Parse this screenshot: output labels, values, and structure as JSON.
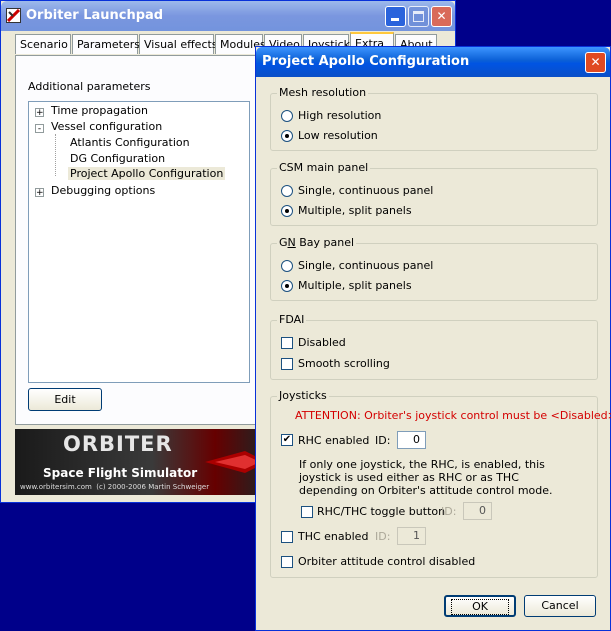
{
  "launchpad": {
    "title": "Orbiter Launchpad",
    "tabs": [
      "Scenario",
      "Parameters",
      "Visual effects",
      "Modules",
      "Video",
      "Joystick",
      "Extra",
      "About"
    ],
    "section_label": "Additional parameters",
    "tree": [
      {
        "label": "Time propagation",
        "expander": "+"
      },
      {
        "label": "Vessel configuration",
        "expander": "-"
      },
      {
        "label": "Atlantis Configuration"
      },
      {
        "label": "DG Configuration"
      },
      {
        "label": "Project Apollo Configuration"
      },
      {
        "label": "Debugging options",
        "expander": "+"
      }
    ],
    "edit_button": "Edit",
    "banner": {
      "name": "ORBITER",
      "subtitle": "Space Flight Simulator",
      "footer": "www.orbitersim.com  (c) 2000-2006 Martin Schweiger"
    }
  },
  "apollo": {
    "title": "Project Apollo Configuration",
    "mesh": {
      "label": "Mesh resolution",
      "options": [
        "High resolution",
        "Low resolution"
      ],
      "selected": "Low resolution"
    },
    "csm": {
      "label": "CSM main panel",
      "options": [
        "Single, continuous panel",
        "Multiple, split panels"
      ],
      "selected": "Multiple, split panels"
    },
    "gn": {
      "label_prefix": "G",
      "label_underlined": "N",
      "label_suffix": " Bay panel",
      "options": [
        "Single, continuous panel",
        "Multiple, split panels"
      ],
      "selected": "Multiple, split panels"
    },
    "fdai": {
      "label": "FDAI",
      "disabled": "Disabled",
      "smooth": "Smooth scrolling"
    },
    "joysticks": {
      "label": "Joysticks",
      "attention": "ATTENTION: Orbiter's joystick control must be <Disabled>!",
      "rhc_label": "RHC enabled",
      "rhc_check": "✔",
      "id_label": "ID:",
      "rhc_id": "0",
      "info": "If only one joystick, the RHC, is enabled, this joystick is used either as RHC or as THC depending on Orbiter's attitude control mode.",
      "toggle_label": "RHC/THC toggle button",
      "toggle_id": "0",
      "thc_label": "THC enabled",
      "thc_id": "1",
      "attitude_label": "Orbiter attitude control disabled"
    },
    "ok": "OK",
    "cancel": "Cancel"
  },
  "colors": {
    "xp_blue": "#0054e3",
    "attention": "#d40000",
    "close_red": "#e04a22"
  }
}
